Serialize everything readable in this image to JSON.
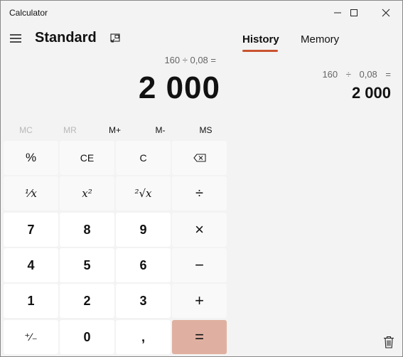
{
  "window": {
    "title": "Calculator",
    "minimize_icon": "minimize-icon",
    "maximize_icon": "maximize-icon",
    "close_icon": "close-icon"
  },
  "header": {
    "menu_icon": "hamburger-menu-icon",
    "mode": "Standard",
    "keep_on_top_icon": "keep-on-top-icon"
  },
  "display": {
    "expression": "160 ÷ 0,08 =",
    "result": "2 000"
  },
  "memory_buttons": [
    {
      "label": "MC",
      "enabled": false
    },
    {
      "label": "MR",
      "enabled": false
    },
    {
      "label": "M+",
      "enabled": true
    },
    {
      "label": "M-",
      "enabled": true
    },
    {
      "label": "MS",
      "enabled": true
    }
  ],
  "keypad": {
    "rows": [
      [
        {
          "label": "%",
          "kind": "op"
        },
        {
          "label": "CE",
          "kind": "op"
        },
        {
          "label": "C",
          "kind": "op"
        },
        {
          "label": "⌫",
          "kind": "op",
          "icon": "backspace-icon"
        }
      ],
      [
        {
          "label": "¹⁄x",
          "kind": "op"
        },
        {
          "label": "x²",
          "kind": "op"
        },
        {
          "label": "²√x",
          "kind": "op"
        },
        {
          "label": "÷",
          "kind": "op"
        }
      ],
      [
        {
          "label": "7",
          "kind": "num"
        },
        {
          "label": "8",
          "kind": "num"
        },
        {
          "label": "9",
          "kind": "num"
        },
        {
          "label": "×",
          "kind": "op"
        }
      ],
      [
        {
          "label": "4",
          "kind": "num"
        },
        {
          "label": "5",
          "kind": "num"
        },
        {
          "label": "6",
          "kind": "num"
        },
        {
          "label": "−",
          "kind": "op"
        }
      ],
      [
        {
          "label": "1",
          "kind": "num"
        },
        {
          "label": "2",
          "kind": "num"
        },
        {
          "label": "3",
          "kind": "num"
        },
        {
          "label": "+",
          "kind": "op"
        }
      ],
      [
        {
          "label": "⁺∕₋",
          "kind": "num"
        },
        {
          "label": "0",
          "kind": "num"
        },
        {
          "label": ",",
          "kind": "num"
        },
        {
          "label": "=",
          "kind": "equals"
        }
      ]
    ]
  },
  "panel": {
    "tabs": [
      {
        "label": "History",
        "active": true
      },
      {
        "label": "Memory",
        "active": false
      }
    ],
    "history": [
      {
        "expression": "160 ÷ 0,08 =",
        "result": "2 000"
      }
    ],
    "trash_icon": "trash-icon"
  },
  "colors": {
    "accent": "#c9532f",
    "equals_key": "#dfb0a1",
    "background": "#f3f3f3",
    "number_key": "#ffffff",
    "operator_key": "#f9f9f9"
  }
}
